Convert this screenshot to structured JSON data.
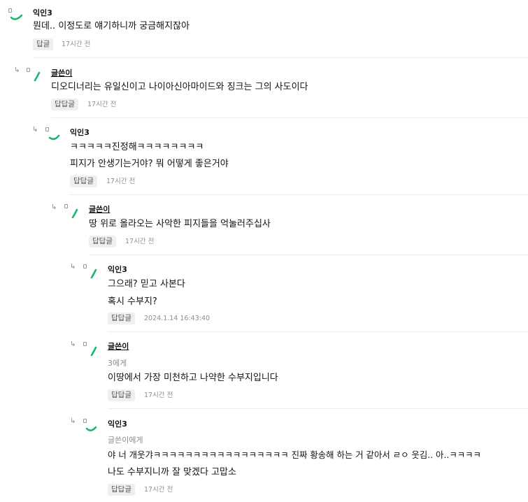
{
  "comments": [
    {
      "author": "익인3",
      "mention": "",
      "lines": [
        "뭔데.. 이정도로 얘기하니까 궁금해지잖아"
      ],
      "reply_label": "답글",
      "time": "17시간 전"
    },
    {
      "author": "글쓴이",
      "mention": "",
      "lines": [
        "디오디너리는 유일신이고 나이아신아마이드와 징크는 그의 사도이다"
      ],
      "reply_label": "답답글",
      "time": "17시간 전"
    },
    {
      "author": "익인3",
      "mention": "",
      "lines": [
        "ㅋㅋㅋㅋㅋ진정해ㅋㅋㅋㅋㅋㅋㅋㅋ",
        "피지가 안생기는거야? 뭐 어떻게 좋은거야"
      ],
      "reply_label": "답답글",
      "time": "17시간 전"
    },
    {
      "author": "글쓴이",
      "mention": "",
      "lines": [
        "땅 위로 올라오는 사악한 피지들을 억눌러주십사"
      ],
      "reply_label": "답답글",
      "time": "17시간 전"
    },
    {
      "author": "익인3",
      "mention": "",
      "lines": [
        "그으래? 믿고 사본다",
        "혹시 수부지?"
      ],
      "reply_label": "답답글",
      "time": "2024.1.14 16:43:40"
    },
    {
      "author": "글쓴이",
      "mention": "3에게",
      "lines": [
        "이땅에서 가장 미천하고 나약한 수부지입니다"
      ],
      "reply_label": "답답글",
      "time": "17시간 전"
    },
    {
      "author": "익인3",
      "mention": "글쓴이에게",
      "lines": [
        "야 너 개웃갸ㅋㅋㅋㅋㅋㅋㅋㅋㅋㅋㅋㅋㅋㅋㅋㅋㅋ 진짜 황송해 하는 거 같아서 ㄹㅇ 웃김.. 아..ㅋㅋㅋㅋ",
        "나도 수부지니까 잘 맞겠다 고맙소"
      ],
      "reply_label": "답답글",
      "time": "17시간 전"
    }
  ],
  "colors": {
    "accent": "#1fb56a",
    "muted": "#8e8e8e",
    "button_bg": "#efefef",
    "divider": "#ececec"
  },
  "icons": {
    "reply": "reply-arrow-icon",
    "avatar": "avatar-swoosh-icon"
  }
}
